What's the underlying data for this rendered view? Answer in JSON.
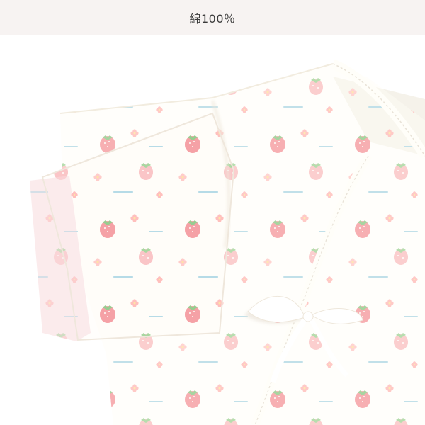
{
  "banner": {
    "text": "綿100％"
  },
  "photo": {
    "subject": "baby-kimono-garment",
    "colors": {
      "fabric": "#fffdf6",
      "strawberry": "#f0707b",
      "strawberry_light": "#f7a8ae",
      "leaf": "#62b35a",
      "flower": "#ff9f9f",
      "text_blue": "#8fc9df",
      "shadow": "#e9e3d8"
    },
    "print_text": "strawberry"
  }
}
